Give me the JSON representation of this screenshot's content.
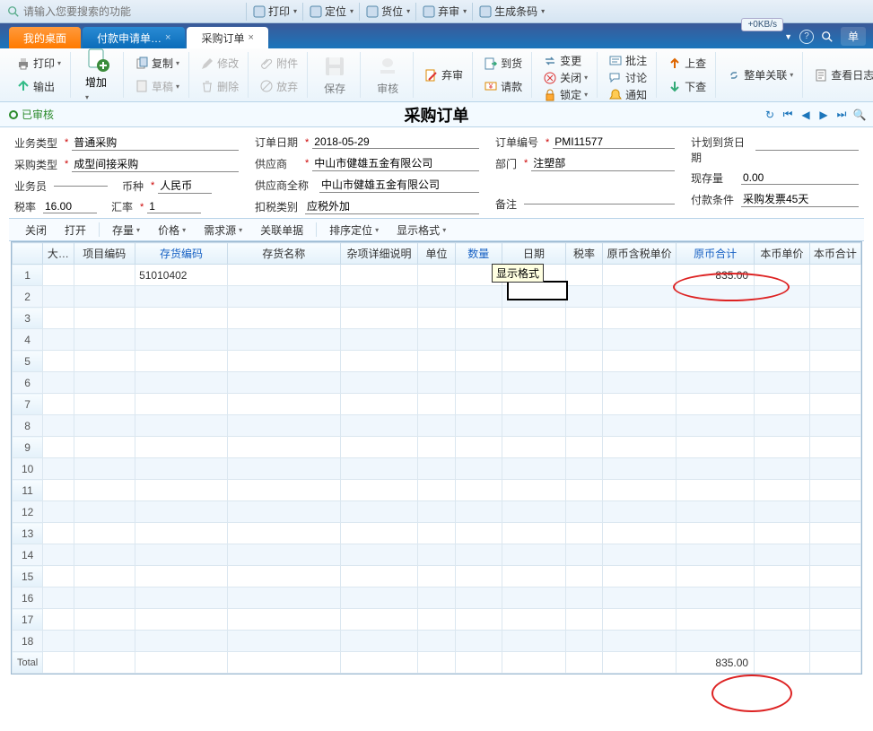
{
  "top_toolbar": {
    "search_placeholder": "请输入您要搜索的功能",
    "buttons": [
      {
        "label": "打印",
        "name": "top-print"
      },
      {
        "label": "定位",
        "name": "top-locate"
      },
      {
        "label": "货位",
        "name": "top-slot"
      },
      {
        "label": "弃审",
        "name": "top-reject"
      },
      {
        "label": "生成条码",
        "name": "top-barcode"
      }
    ],
    "speed": "+0KB/s"
  },
  "tabs": {
    "items": [
      {
        "label": "我的桌面",
        "style": "orange",
        "name": "tab-desktop"
      },
      {
        "label": "付款申请单…",
        "style": "blue",
        "name": "tab-payment"
      },
      {
        "label": "采购订单",
        "style": "active",
        "name": "tab-po"
      }
    ],
    "help_label": "?",
    "search_label": "单"
  },
  "ribbon": {
    "print": "打印",
    "export": "输出",
    "add": "增加",
    "copy": "复制",
    "edit": "修改",
    "attach": "附件",
    "draft": "草稿",
    "delete": "删除",
    "release": "放弃",
    "save": "保存",
    "audit": "审核",
    "reject": "弃审",
    "arrive": "到货",
    "invoice": "请款",
    "change": "变更",
    "close": "关闭",
    "lock": "锁定",
    "approve": "批注",
    "discuss": "讨论",
    "notify": "通知",
    "up": "上查",
    "down": "下查",
    "link": "整单关联",
    "log": "查看日志"
  },
  "title_bar": {
    "approved": "已审核",
    "doc_title": "采购订单"
  },
  "form": {
    "biz_type_lbl": "业务类型",
    "biz_type_val": "普通采购",
    "pur_type_lbl": "采购类型",
    "pur_type_val": "成型间接采购",
    "salesman_lbl": "业务员",
    "taxrate_lbl": "税率",
    "taxrate_val": "16.00",
    "currency_lbl": "币种",
    "currency_val": "人民币",
    "exrate_lbl": "汇率",
    "exrate_val": "1",
    "order_date_lbl": "订单日期",
    "order_date_val": "2018-05-29",
    "supplier_lbl": "供应商",
    "supplier_val": "中山市健雄五金有限公司",
    "supplier_full_lbl": "供应商全称",
    "supplier_full_val": "中山市健雄五金有限公司",
    "tax_cat_lbl": "扣税类别",
    "tax_cat_val": "应税外加",
    "order_no_lbl": "订单编号",
    "order_no_val": "PMI11577",
    "dept_lbl": "部门",
    "dept_val": "注塑部",
    "remark_lbl": "备注",
    "plan_date_lbl": "计划到货日期",
    "stock_lbl": "现存量",
    "stock_val": "0.00",
    "pay_term_lbl": "付款条件",
    "pay_term_val": "采购发票45天"
  },
  "sub_toolbar": {
    "close": "关闭",
    "open": "打开",
    "stock": "存量",
    "price": "价格",
    "demand": "需求源",
    "related": "关联单据",
    "sort": "排序定位",
    "display": "显示格式"
  },
  "grid": {
    "headers": {
      "rownum": "",
      "big": "大…",
      "proj": "项目编码",
      "stockcode": "存货编码",
      "stockname": "存货名称",
      "misc": "杂项详细说明",
      "unit": "单位",
      "qty": "数量",
      "date": "日期",
      "taxrate": "税率",
      "orig_unit": "原币含税单价",
      "orig_total": "原币合计",
      "local_unit": "本币单价",
      "local_total": "本币合计"
    },
    "tooltip": "显示格式",
    "rows": [
      {
        "n": "1",
        "stockcode": "51010402",
        "orig_total": "835.00"
      },
      {
        "n": "2"
      },
      {
        "n": "3"
      },
      {
        "n": "4"
      },
      {
        "n": "5"
      },
      {
        "n": "6"
      },
      {
        "n": "7"
      },
      {
        "n": "8"
      },
      {
        "n": "9"
      },
      {
        "n": "10"
      },
      {
        "n": "11"
      },
      {
        "n": "12"
      },
      {
        "n": "13"
      },
      {
        "n": "14"
      },
      {
        "n": "15"
      },
      {
        "n": "16"
      },
      {
        "n": "17"
      },
      {
        "n": "18"
      }
    ],
    "total_label": "Total",
    "total_orig": "835.00"
  }
}
